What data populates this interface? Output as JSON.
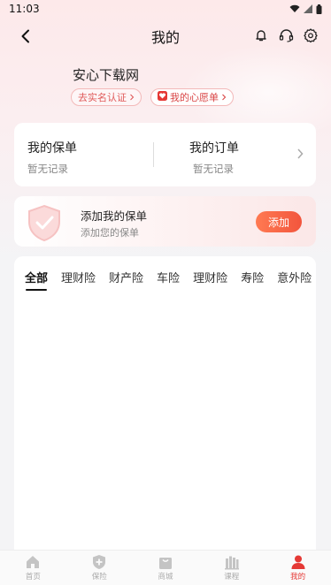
{
  "status_bar": {
    "time": "11:03"
  },
  "nav": {
    "title": "我的"
  },
  "user": {
    "name": "安心下载网",
    "verify_label": "去实名认证",
    "wishlist_label": "我的心愿单"
  },
  "policy_card": {
    "my_policy_title": "我的保单",
    "my_policy_status": "暂无记录",
    "my_order_title": "我的订单",
    "my_order_status": "暂无记录"
  },
  "add_card": {
    "title": "添加我的保单",
    "subtitle": "添加您的保单",
    "button_label": "添加"
  },
  "tabs": [
    "全部",
    "理财险",
    "财产险",
    "车险",
    "理财险",
    "寿险",
    "意外险"
  ],
  "bottom_nav": [
    {
      "label": "首页",
      "icon": "home-icon"
    },
    {
      "label": "保险",
      "icon": "shield-plus-icon"
    },
    {
      "label": "商城",
      "icon": "bag-icon"
    },
    {
      "label": "课程",
      "icon": "books-icon"
    },
    {
      "label": "我的",
      "icon": "person-icon"
    }
  ],
  "colors": {
    "accent": "#e53935",
    "button": "#f2553d",
    "page_bg": "#f4f4f6"
  }
}
